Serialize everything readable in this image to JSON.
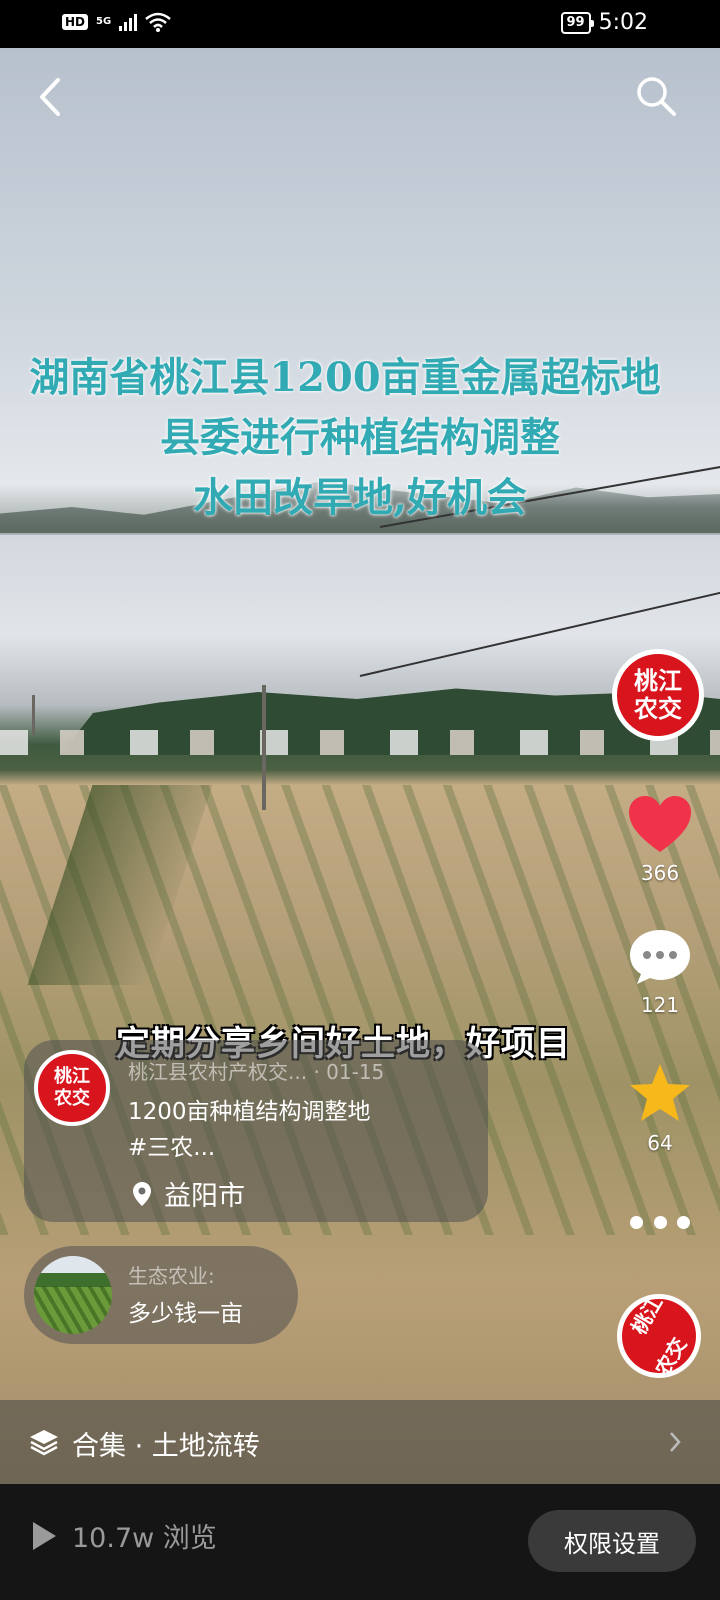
{
  "status_bar": {
    "network_hd": "HD",
    "network_5g": "5G",
    "battery": "99",
    "time": "5:02"
  },
  "video_overlay": {
    "title_line1": "湖南省桃江县1200亩重金属超标地",
    "title_line2": "县委进行种植结构调整",
    "title_line3": "水田改旱地,好机会",
    "color": "#31aab4"
  },
  "caption": "定期分享乡间好土地，好项目",
  "author_avatar_text": [
    "桃江",
    "农交"
  ],
  "actions": {
    "likes": "366",
    "comments": "121",
    "favorites": "64"
  },
  "post_card": {
    "author": "桃江县农村产权交...",
    "date": "· 01-15",
    "desc_line1": "1200亩种植结构调整地",
    "desc_line2": "#三农...",
    "location": "益阳市"
  },
  "related_card": {
    "category": "生态农业:",
    "title": "多少钱一亩"
  },
  "collection": {
    "label": "合集 · 土地流转"
  },
  "bottom_bar": {
    "views": "10.7w 浏览",
    "permission_button": "权限设置"
  },
  "colors": {
    "brand_red": "#d8141c",
    "like_red": "#f0324a",
    "star_yellow": "#f6b81b"
  },
  "icons": [
    "back-icon",
    "search-icon",
    "heart-icon",
    "comment-icon",
    "star-icon",
    "more-icon",
    "location-pin-icon",
    "layers-icon",
    "chevron-right-icon",
    "play-icon"
  ]
}
